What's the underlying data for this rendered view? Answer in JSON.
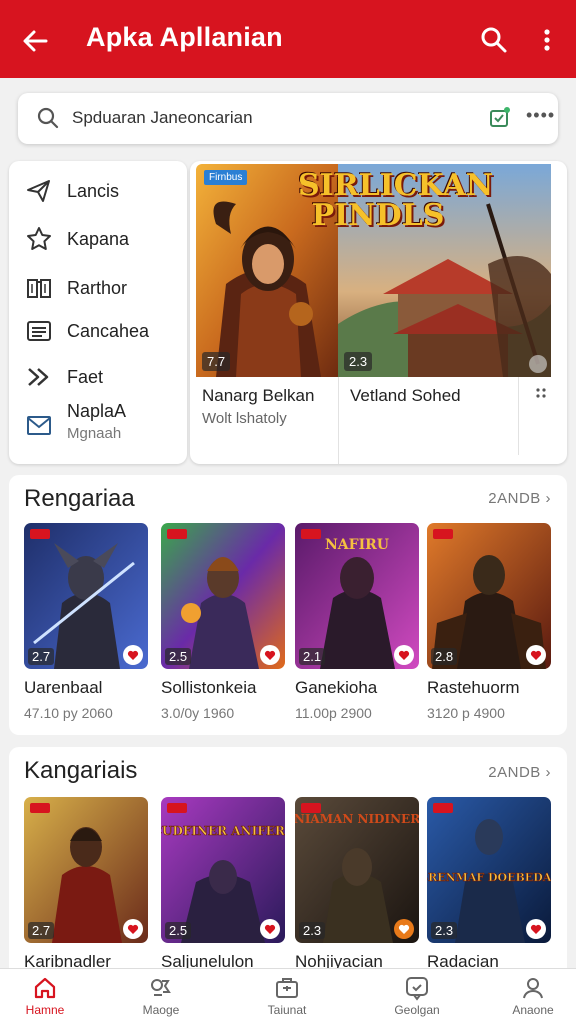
{
  "appbar": {
    "title": "Apka Apllanian"
  },
  "search": {
    "value": "Spduaran Janeoncarian",
    "more": "••••"
  },
  "sidebar": {
    "items": [
      {
        "label": "Lancis",
        "icon": "paper-plane-icon"
      },
      {
        "label": "Kapana",
        "icon": "star-outline-icon"
      },
      {
        "label": "Rarthor",
        "icon": "book-icon"
      },
      {
        "label": "Cancahea",
        "icon": "list-icon"
      },
      {
        "label": "Faet",
        "icon": "fast-forward-icon"
      },
      {
        "label": "NaplaA",
        "sublabel": "Mgnaah",
        "icon": "mail-icon"
      }
    ]
  },
  "featured": {
    "badge": "Firnbus",
    "logo_text": "SIRLICKAN PINDLS",
    "items": [
      {
        "rating": "7.7",
        "title": "Nanarg Belkan",
        "subtitle": "Wolt lshatoly"
      },
      {
        "rating": "2.3",
        "title": "Vetland Sohed",
        "subtitle": ""
      }
    ]
  },
  "section1": {
    "title": "Rengariaa",
    "more": "2ANDB",
    "cards": [
      {
        "rating": "2.7",
        "name": "Uarenbaal",
        "meta": "47.10 py 2060"
      },
      {
        "rating": "2.5",
        "name": "Sollistonkeia",
        "meta": "3.0/0y 1960"
      },
      {
        "rating": "2.1",
        "name": "Ganekioha",
        "meta": "11.00p 2900"
      },
      {
        "rating": "2.8",
        "name": "Rastehuorm",
        "meta": "3120 p 4900"
      }
    ]
  },
  "section2": {
    "title": "Kangariais",
    "more": "2ANDB",
    "cards": [
      {
        "rating": "2.7",
        "name": "Karibnadler",
        "art_text": ""
      },
      {
        "rating": "2.5",
        "name": "Saljunelulon",
        "art_text": "CUDFINER ANIFERS"
      },
      {
        "rating": "2.3",
        "name": "Nohjiyacian",
        "art_text": "NIAMAN NIDINER"
      },
      {
        "rating": "2.3",
        "name": "Radacian",
        "art_text": "BRENMAF DOEBEDAS"
      }
    ]
  },
  "bottomnav": {
    "items": [
      {
        "label": "Hamne",
        "icon": "home-icon"
      },
      {
        "label": "Maoge",
        "icon": "gamepad-icon"
      },
      {
        "label": "Taiunat",
        "icon": "briefcase-icon"
      },
      {
        "label": "Geolgan",
        "icon": "chat-icon"
      },
      {
        "label": "Anaone",
        "icon": "profile-icon"
      }
    ]
  },
  "colors": {
    "accent": "#d7141f",
    "badge_blue": "#2a7fd4"
  }
}
